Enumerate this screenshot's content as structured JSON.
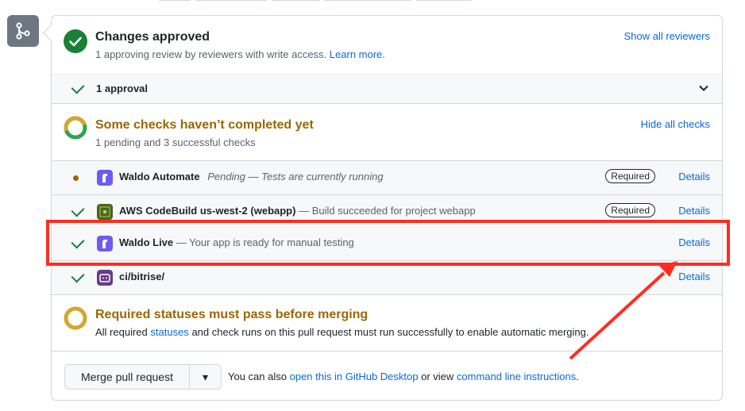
{
  "approved": {
    "title": "Changes approved",
    "sub_text": "1 approving review by reviewers with write access.",
    "learn_more": "Learn more.",
    "show_reviewers": "Show all reviewers"
  },
  "approval_bar": {
    "label": "1 approval"
  },
  "checks": {
    "title": "Some checks haven’t completed yet",
    "summary": "1 pending and 3 successful checks",
    "hide_label": "Hide all checks",
    "rows": [
      {
        "name": "Waldo Automate",
        "desc": "Pending — Tests are currently running",
        "status": "pending",
        "badge": "Required",
        "details": "Details"
      },
      {
        "name": "AWS CodeBuild us-west-2 (webapp)",
        "desc": "— Build succeeded for project webapp",
        "status": "success",
        "badge": "Required",
        "details": "Details"
      },
      {
        "name": "Waldo Live",
        "desc": "— Your app is ready for manual testing",
        "status": "success",
        "details": "Details"
      },
      {
        "name": "ci/bitrise/",
        "desc": "",
        "status": "success",
        "details": "Details"
      }
    ]
  },
  "required": {
    "title": "Required statuses must pass before merging",
    "text_before": "All required",
    "statuses_link": "statuses",
    "text_after": "and check runs on this pull request must run successfully to enable automatic merging."
  },
  "merge": {
    "button_label": "Merge pull request",
    "caret": "▾",
    "also_text": "You can also",
    "desktop_link": "open this in GitHub Desktop",
    "or_view": "or view",
    "cli_link": "command line instructions",
    "period": "."
  },
  "colors": {
    "success": "#1a7f37",
    "pending": "#9a6700",
    "link": "#0969da",
    "annotation_red": "#ff2d20",
    "waldo_purple": "#6e5cf0",
    "bitrise_purple": "#683d87"
  },
  "icons": {
    "merge": "git-merge-icon",
    "approved": "check-circle-icon",
    "checks": "progress-ring-icon",
    "required": "dot-circle-icon"
  }
}
